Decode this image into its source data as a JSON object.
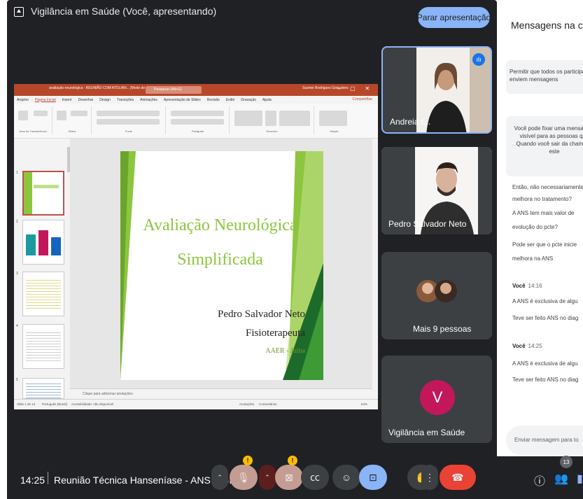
{
  "header": {
    "presenting_title": "Vigilância em Saúde (Você, apresentando)",
    "stop_button": "Parar apresentação"
  },
  "powerpoint": {
    "window_title": "avaliação neurológica - REUNIÃO COM ATOLIAN... [Modo de Compatibilidade] - PowerPoint",
    "search_placeholder": "Pesquisar (Alt+G)",
    "user_name": "Suzinei Rodrigues Gonçalves",
    "menu": [
      "Arquivo",
      "Página Inicial",
      "Inserir",
      "Desenhar",
      "Design",
      "Transições",
      "Animações",
      "Apresentação de Slides",
      "Revisão",
      "Exibir",
      "Gravação",
      "Ajuda"
    ],
    "share_label": "Compartilhar",
    "ribbon_groups": [
      "Área de Transferência",
      "Slides",
      "Fonte",
      "Parágrafo",
      "Desenho",
      "Edição"
    ],
    "thumbnail_numbers": [
      "1",
      "2",
      "3",
      "4",
      "5"
    ],
    "notes_placeholder": "Clique para adicionar anotações",
    "status_left": "Slide 1 de 13",
    "status_lang": "Português (Brasil)",
    "status_access": "Acessibilidade: não disponível",
    "status_notes": "Anotações",
    "status_comments": "Comentários",
    "zoom": "54%",
    "slide": {
      "title": "Avaliação Neurológica Simplificada",
      "author": "Pedro Salvador Neto",
      "role": "Fisioterapeuta",
      "org": "AAER - Juína"
    }
  },
  "participants": [
    {
      "name": "Andreia t...",
      "speaking": true
    },
    {
      "name": "Pedro Salvador Neto"
    },
    {
      "name": "Mais 9 pessoas"
    },
    {
      "name": "Vigilância em Saúde",
      "avatar_letter": "V",
      "avatar_color": "#c2185b"
    }
  ],
  "chat": {
    "title": "Mensagens na chamada",
    "permission_text": "Permitir que todos os participantes enviem mensagens",
    "pin_text": [
      "Você pode fixar uma mensagem",
      "visível para as pessoas que",
      "Quando você sair da chamada",
      "este"
    ],
    "messages_top": [
      "Então, não necessariamente",
      "melhora no tratamento?",
      "A ANS tem mais valor de",
      "evolução do pcte?",
      "Pode ser que o pcte inicie",
      "melhora na ANS"
    ],
    "groups": [
      {
        "sender": "Você",
        "time": "14:16",
        "lines": [
          "A ANS é exclusiva de algu",
          "Teve ser feito ANS no diag"
        ]
      },
      {
        "sender": "Você",
        "time": "14:25",
        "lines": [
          "A ANS é exclusiva de algu",
          "Teve ser feito ANS no diag"
        ]
      }
    ],
    "input_placeholder": "Enviar mensagem para to"
  },
  "bottom_bar": {
    "clock": "14:25",
    "meeting_name": "Reunião Técnica Hanseníase - ANS e GIF - ...",
    "participants_count": "13",
    "warn_symbol": "!"
  },
  "colors": {
    "meet_bg": "#202124",
    "accent_blue": "#8ab4f8",
    "end_red": "#ea4335",
    "ppt_red": "#b7472a",
    "slide_green": "#8cc63e"
  }
}
